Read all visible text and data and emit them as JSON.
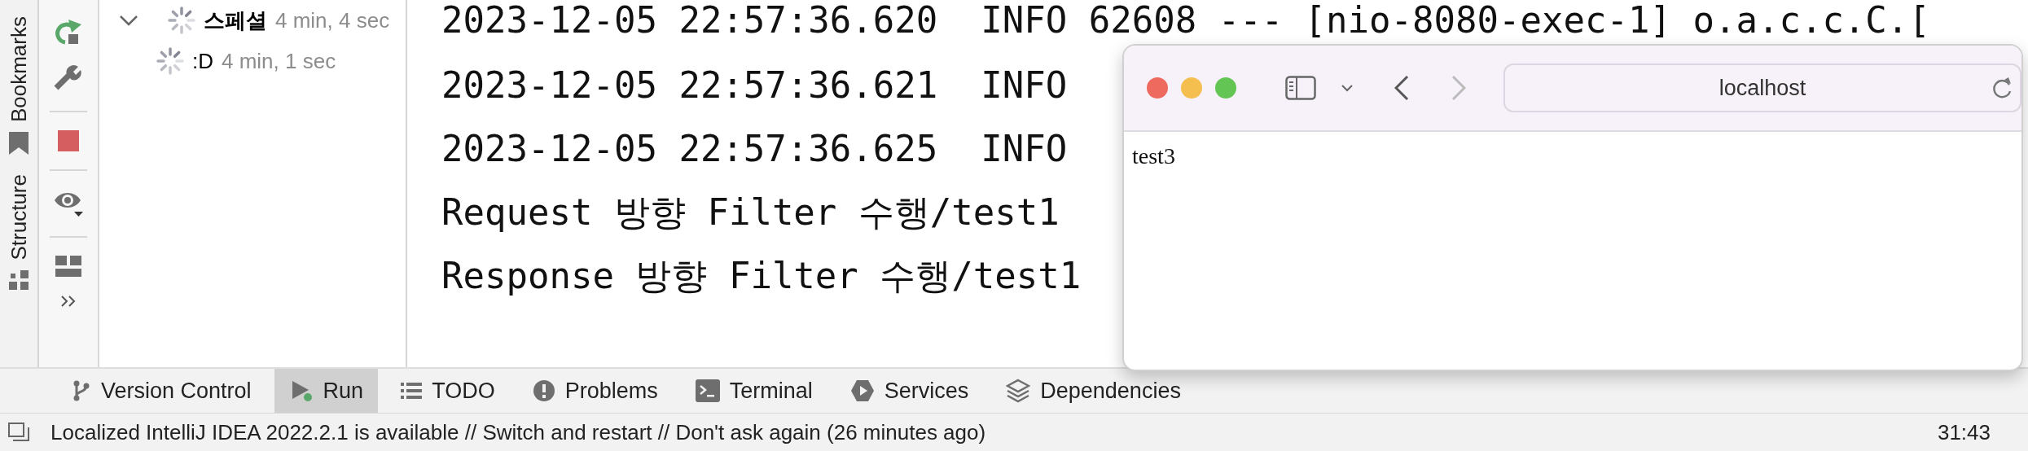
{
  "sidebar": {
    "items": [
      {
        "label": "Bookmarks"
      },
      {
        "label": "Structure"
      }
    ]
  },
  "run_tree": [
    {
      "label": "스페셜",
      "time": "4 min, 4 sec",
      "expanded": true,
      "children": [
        {
          "label": ":D",
          "time": "4 min, 1 sec"
        }
      ]
    }
  ],
  "console": {
    "lines": [
      "2023-12-05 22:57:36.620  INFO 62608 --- [nio-8080-exec-1] o.a.c.c.C.[",
      "2023-12-05 22:57:36.621  INFO",
      "2023-12-05 22:57:36.625  INFO",
      "Request 방향 Filter 수행/test1",
      "Response 방향 Filter 수행/test1"
    ]
  },
  "tool_tabs": [
    {
      "label": "Version Control",
      "selected": false
    },
    {
      "label": "Run",
      "selected": true
    },
    {
      "label": "TODO",
      "selected": false
    },
    {
      "label": "Problems",
      "selected": false
    },
    {
      "label": "Terminal",
      "selected": false
    },
    {
      "label": "Services",
      "selected": false
    },
    {
      "label": "Dependencies",
      "selected": false
    }
  ],
  "status_bar": {
    "message": "Localized IntelliJ IDEA 2022.2.1 is available // Switch and restart // Don't ask again (26 minutes ago)",
    "time": "31:43"
  },
  "browser": {
    "url": "localhost",
    "body": "test3"
  }
}
